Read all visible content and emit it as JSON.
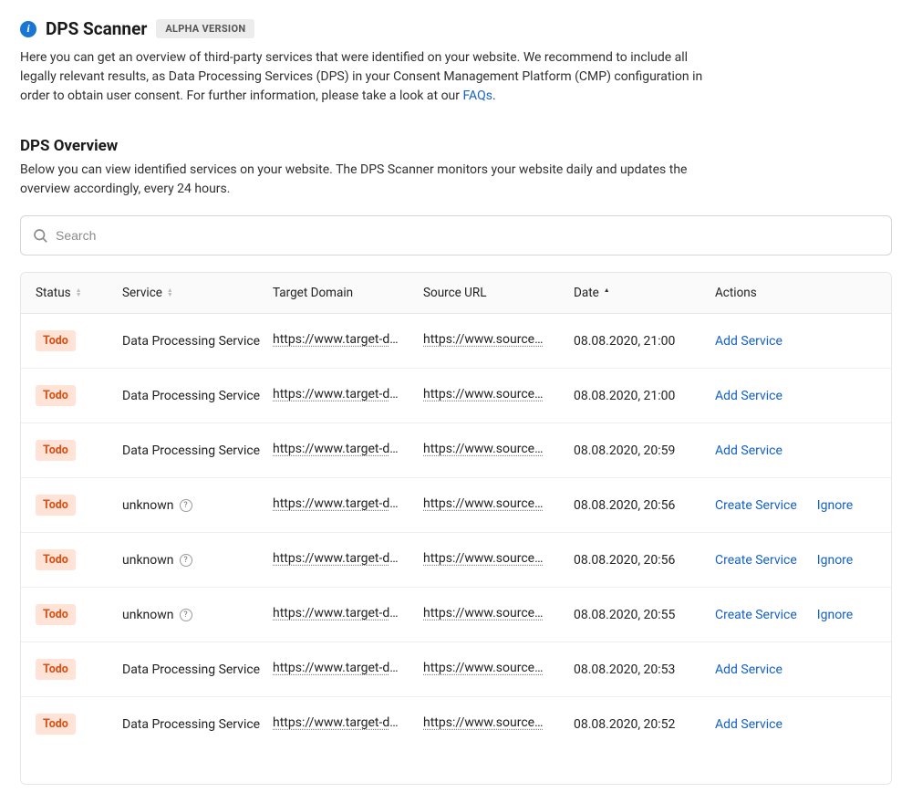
{
  "header": {
    "title": "DPS Scanner",
    "badge": "ALPHA VERSION",
    "intro_pre": "Here you can get an overview of third-party services that were identified on your website. We recommend to include all legally relevant results, as Data Processing Services (DPS) in your Consent Management Platform (CMP) configuration in order to obtain user consent. For further information, please take a look at our ",
    "faq_label": "FAQs",
    "intro_post": "."
  },
  "overview": {
    "title": "DPS Overview",
    "description": "Below you can view identified services on your website. The DPS Scanner monitors your website daily and updates the overview accordingly, every 24 hours."
  },
  "search": {
    "placeholder": "Search"
  },
  "table": {
    "headers": {
      "status": "Status",
      "service": "Service",
      "target": "Target Domain",
      "source": "Source URL",
      "date": "Date",
      "actions": "Actions"
    },
    "action_labels": {
      "add": "Add Service",
      "create": "Create Service",
      "ignore": "Ignore"
    },
    "status_label": "Todo",
    "rows": [
      {
        "service": "Data Processing Service",
        "unknown": false,
        "target": "https://www.target-do…",
        "source": "https://www.source…",
        "date": "08.08.2020, 21:00",
        "actions": [
          "add"
        ]
      },
      {
        "service": "Data Processing Service",
        "unknown": false,
        "target": "https://www.target-do…",
        "source": "https://www.source…",
        "date": "08.08.2020, 21:00",
        "actions": [
          "add"
        ]
      },
      {
        "service": "Data Processing Service",
        "unknown": false,
        "target": "https://www.target-do…",
        "source": "https://www.source…",
        "date": "08.08.2020, 20:59",
        "actions": [
          "add"
        ]
      },
      {
        "service": "unknown",
        "unknown": true,
        "target": "https://www.target-do…",
        "source": "https://www.source…",
        "date": "08.08.2020, 20:56",
        "actions": [
          "create",
          "ignore"
        ]
      },
      {
        "service": "unknown",
        "unknown": true,
        "target": "https://www.target-do…",
        "source": "https://www.source…",
        "date": "08.08.2020, 20:56",
        "actions": [
          "create",
          "ignore"
        ]
      },
      {
        "service": "unknown",
        "unknown": true,
        "target": "https://www.target-do…",
        "source": "https://www.source…",
        "date": "08.08.2020, 20:55",
        "actions": [
          "create",
          "ignore"
        ]
      },
      {
        "service": "Data Processing Service",
        "unknown": false,
        "target": "https://www.target-do…",
        "source": "https://www.source…",
        "date": "08.08.2020, 20:53",
        "actions": [
          "add"
        ]
      },
      {
        "service": "Data Processing Service",
        "unknown": false,
        "target": "https://www.target-do…",
        "source": "https://www.source…",
        "date": "08.08.2020, 20:52",
        "actions": [
          "add"
        ]
      }
    ]
  }
}
